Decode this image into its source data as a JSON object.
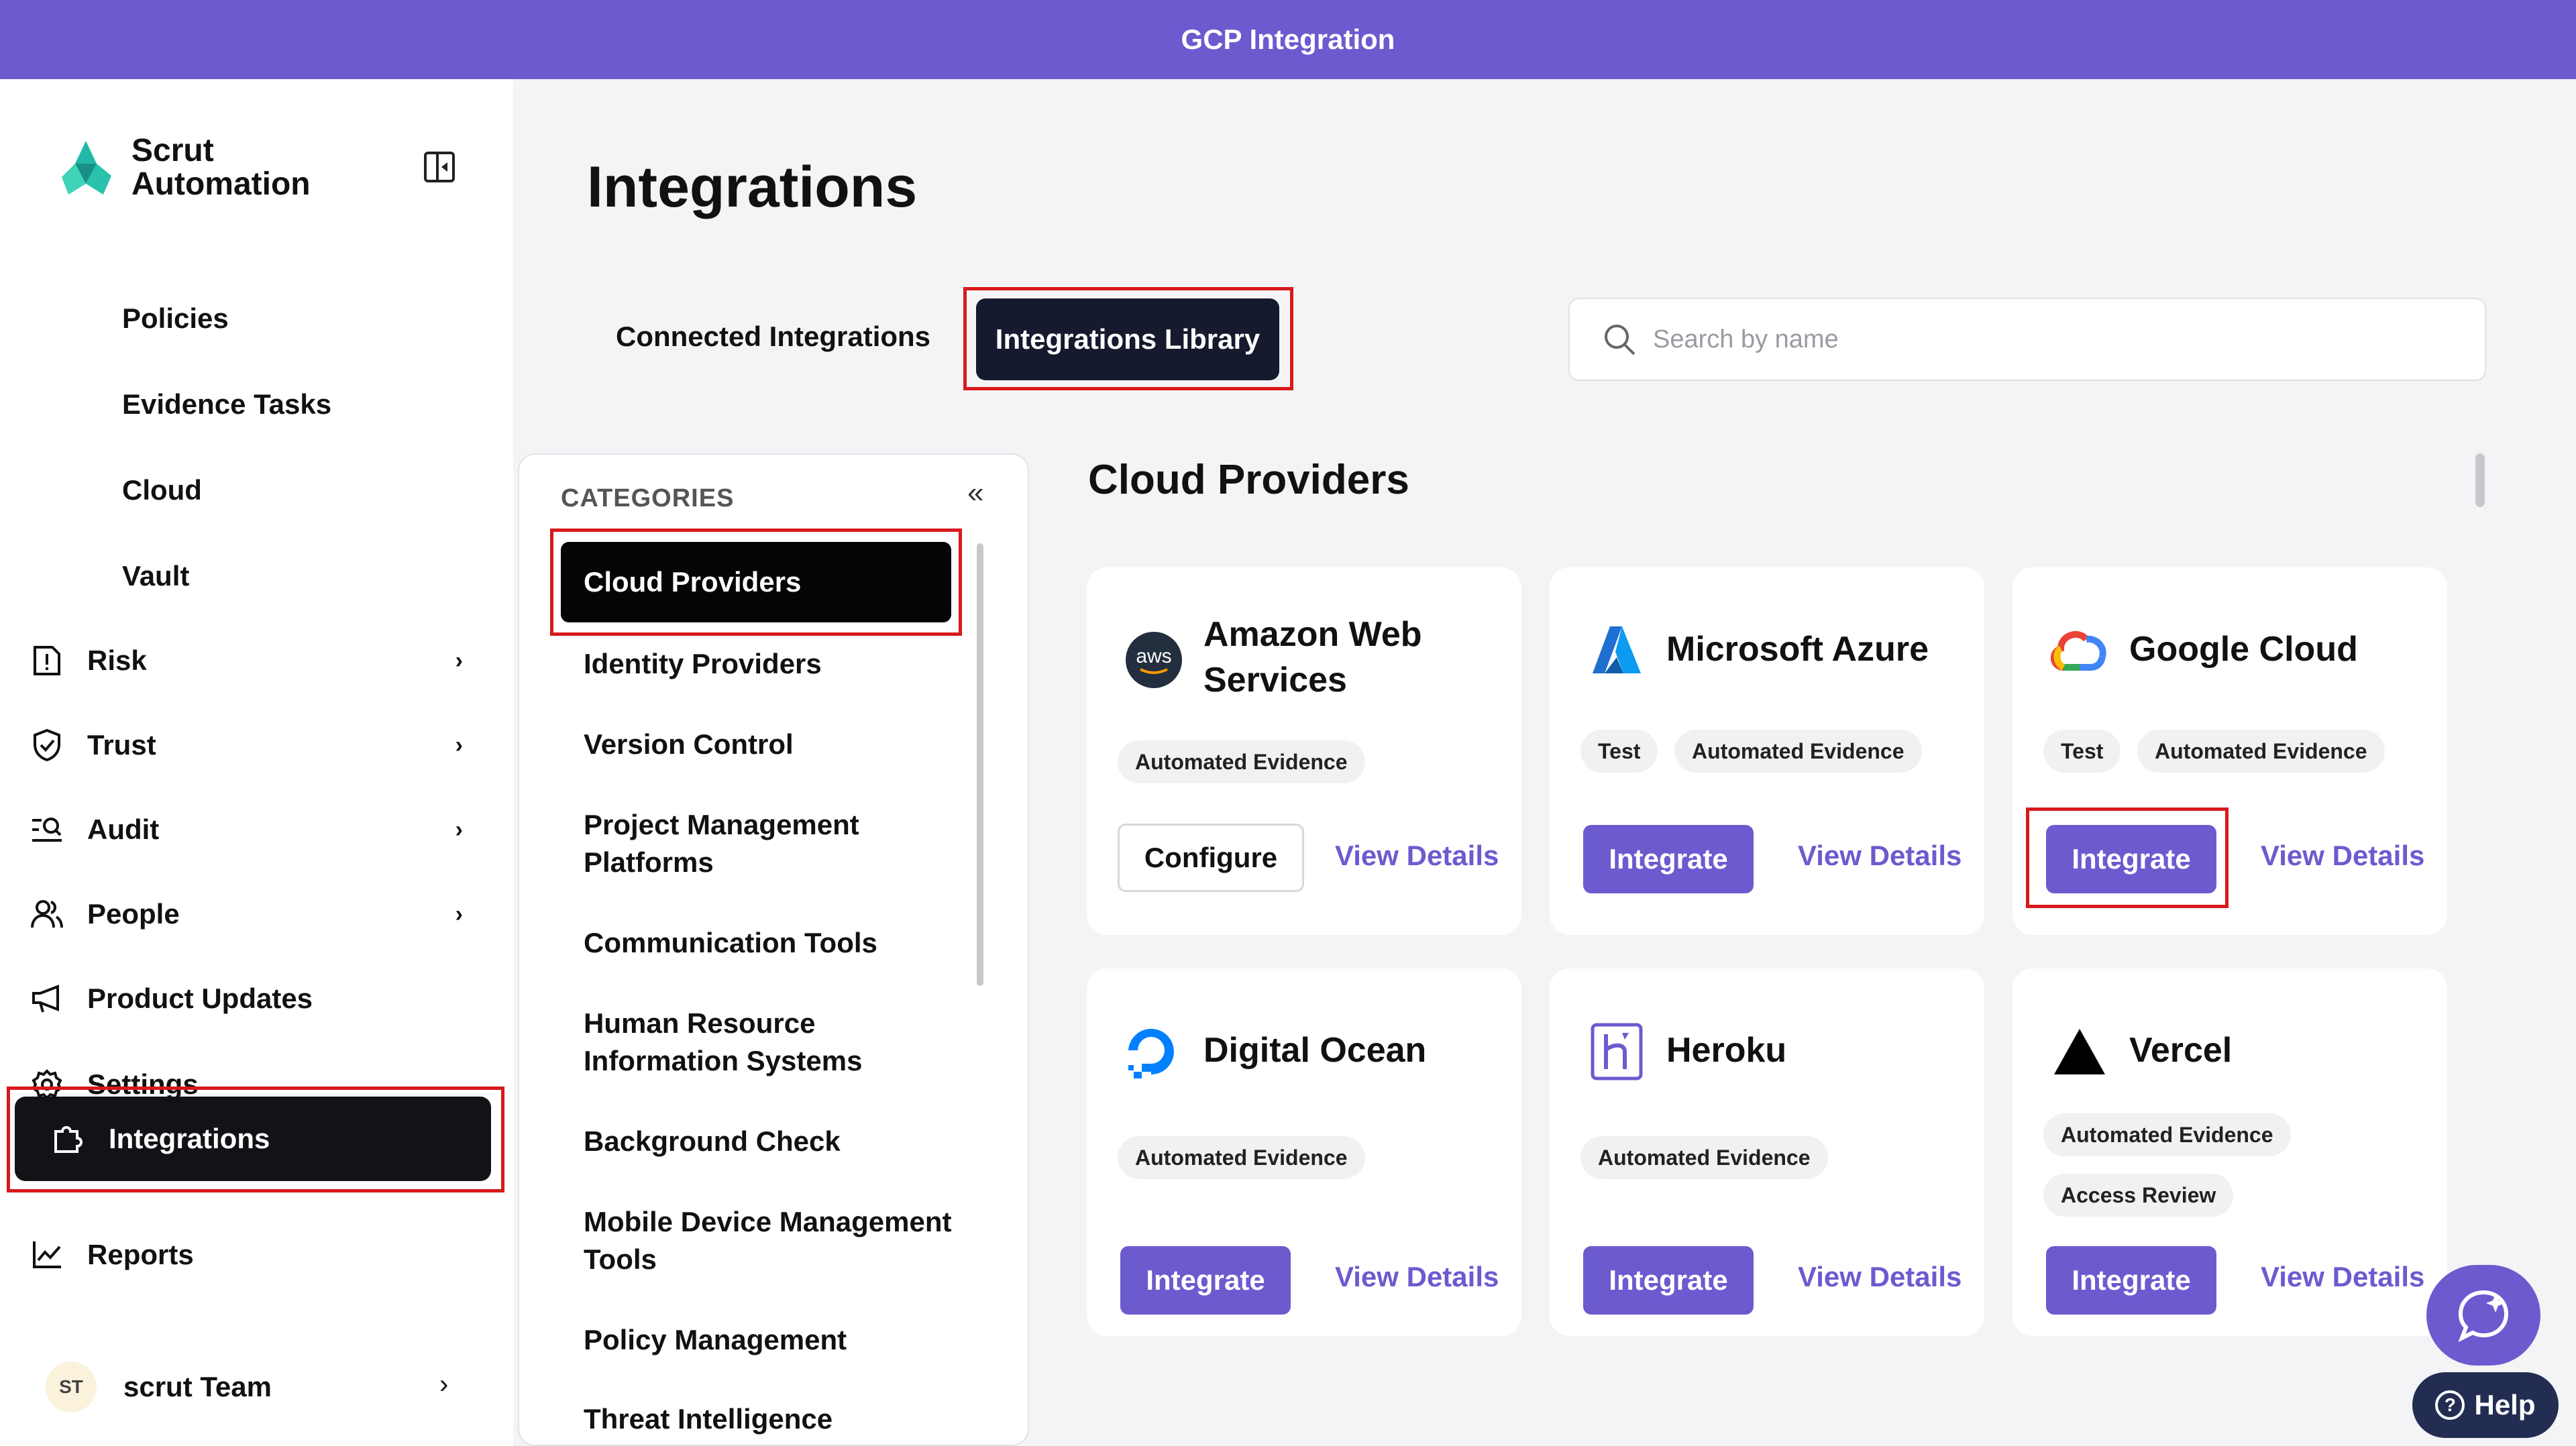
{
  "window": {
    "title": "GCP Integration"
  },
  "brand": {
    "name_line1": "Scrut",
    "name_line2": "Automation"
  },
  "sidebar": {
    "items": [
      {
        "label": "Policies"
      },
      {
        "label": "Evidence Tasks"
      },
      {
        "label": "Cloud"
      },
      {
        "label": "Vault"
      },
      {
        "label": "Risk",
        "icon": "risk-icon"
      },
      {
        "label": "Trust",
        "icon": "shield-check-icon"
      },
      {
        "label": "Audit",
        "icon": "audit-icon"
      },
      {
        "label": "People",
        "icon": "people-icon"
      },
      {
        "label": "Product Updates",
        "icon": "megaphone-icon"
      },
      {
        "label": "Settings",
        "icon": "gear-icon"
      },
      {
        "label": "Integrations",
        "icon": "puzzle-icon",
        "active": true
      },
      {
        "label": "Reports",
        "icon": "chart-icon"
      }
    ],
    "team": {
      "initials": "ST",
      "label": "scrut Team"
    }
  },
  "main": {
    "title": "Integrations",
    "tabs": [
      {
        "label": "Connected Integrations"
      },
      {
        "label": "Integrations Library",
        "active": true
      }
    ],
    "search": {
      "placeholder": "Search by name",
      "value": ""
    },
    "categories": {
      "heading": "CATEGORIES",
      "items": [
        {
          "label": "Cloud Providers",
          "active": true
        },
        {
          "label": "Identity Providers"
        },
        {
          "label": "Version Control"
        },
        {
          "label": "Project Management Platforms"
        },
        {
          "label": "Communication Tools"
        },
        {
          "label": "Human Resource Information Systems"
        },
        {
          "label": "Background Check"
        },
        {
          "label": "Mobile Device Management Tools"
        },
        {
          "label": "Policy Management"
        },
        {
          "label": "Threat Intelligence"
        }
      ]
    },
    "section_title": "Cloud Providers",
    "cards": [
      {
        "name": "Amazon Web Services",
        "tags": [
          "Automated Evidence"
        ],
        "primary": "Configure",
        "secondary": "View Details",
        "logo_text": "aws"
      },
      {
        "name": "Microsoft Azure",
        "tags": [
          "Test",
          "Automated Evidence"
        ],
        "primary": "Integrate",
        "secondary": "View Details"
      },
      {
        "name": "Google Cloud",
        "tags": [
          "Test",
          "Automated Evidence"
        ],
        "primary": "Integrate",
        "secondary": "View Details"
      },
      {
        "name": "Digital Ocean",
        "tags": [
          "Automated Evidence"
        ],
        "primary": "Integrate",
        "secondary": "View Details"
      },
      {
        "name": "Heroku",
        "tags": [
          "Automated Evidence"
        ],
        "primary": "Integrate",
        "secondary": "View Details"
      },
      {
        "name": "Vercel",
        "tags": [
          "Automated Evidence",
          "Access Review"
        ],
        "primary": "Integrate",
        "secondary": "View Details"
      }
    ]
  },
  "help": {
    "label": "Help"
  },
  "colors": {
    "banner": "#6b5bcf",
    "accent": "#6b5bcf",
    "active_bg": "#121317",
    "highlight": "#d8191c"
  }
}
